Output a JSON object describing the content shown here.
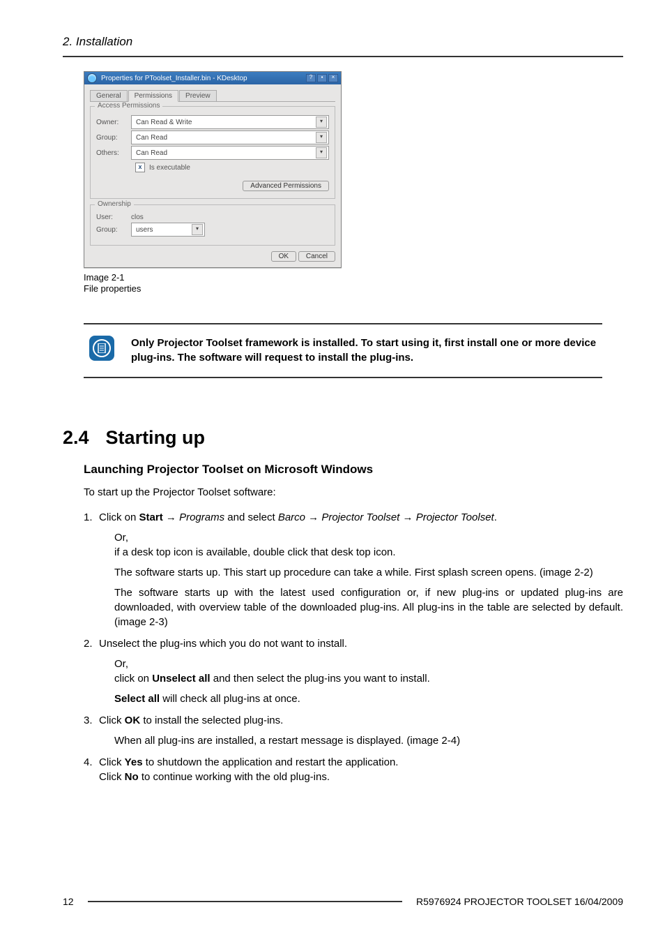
{
  "chapter_header": "2.  Installation",
  "screenshot": {
    "title": "Properties for PToolset_Installer.bin - KDesktop",
    "tabs": {
      "general": "General",
      "permissions": "Permissions",
      "preview": "Preview"
    },
    "access_legend": "Access Permissions",
    "owner_label": "Owner:",
    "owner_value": "Can Read & Write",
    "group_label": "Group:",
    "group_value": "Can Read",
    "others_label": "Others:",
    "others_value": "Can Read",
    "exec_label": "Is executable",
    "advanced": "Advanced Permissions",
    "ownership_legend": "Ownership",
    "user_label": "User:",
    "user_value": "clos",
    "grouprow_label": "Group:",
    "grouprow_value": "users",
    "ok": "OK",
    "cancel": "Cancel"
  },
  "figcaption1": "Image 2-1",
  "figcaption2": "File properties",
  "note": "Only Projector Toolset framework is installed. To start using it, first install one or more device plug-ins. The software will request to install the plug-ins.",
  "section_num": "2.4",
  "section_title": "Starting up",
  "sub_title": "Launching Projector Toolset on Microsoft Windows",
  "intro": "To start up the Projector Toolset software:",
  "step1_a": "Click on ",
  "step1_start": "Start",
  "step1_arrow1": " → ",
  "step1_programs": "Programs",
  "step1_b": " and select ",
  "step1_barco": "Barco",
  "step1_arrow2": " → ",
  "step1_pt1": "Projector Toolset",
  "step1_arrow3": " → ",
  "step1_pt2": "Projector Toolset",
  "step1_end": ".",
  "step1_or": "Or,",
  "step1_desktop": "if a desk top icon is available, double click that desk top icon.",
  "step1_p1": "The software starts up. This start up procedure can take a while. First splash screen opens. (image 2-2)",
  "step1_p2": "The software starts up with the latest used configuration or, if new plug-ins or updated plug-ins are downloaded, with overview table of the downloaded plug-ins. All plug-ins in the table are selected by default. (image 2-3)",
  "step2_a": "Unselect the plug-ins which you do not want to install.",
  "step2_or": "Or,",
  "step2_click": "click on ",
  "step2_unsel": "Unselect all",
  "step2_rest": " and then select the plug-ins you want to install.",
  "step2_selall": "Select all",
  "step2_selrest": " will check all plug-ins at once.",
  "step3_click": "Click ",
  "step3_ok": "OK",
  "step3_rest": " to install the selected plug-ins.",
  "step3_when": "When all plug-ins are installed, a restart message is displayed. (image 2-4)",
  "step4_click": "Click ",
  "step4_yes": "Yes",
  "step4_rest1": " to shutdown the application and restart the application.",
  "step4_click2": "Click ",
  "step4_no": "No",
  "step4_rest2": " to continue working with the old plug-ins.",
  "footer_page": "12",
  "footer_text": "R5976924  PROJECTOR TOOLSET  16/04/2009"
}
